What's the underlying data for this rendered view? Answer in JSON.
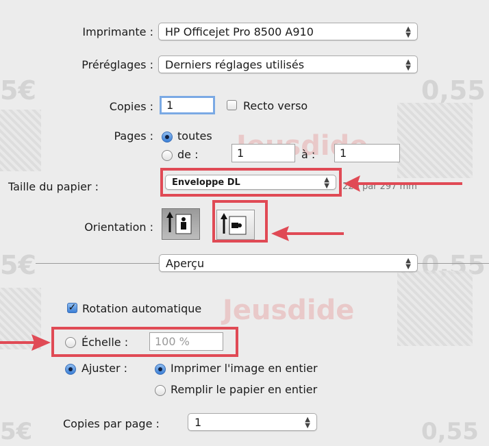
{
  "printer": {
    "label": "Imprimante :",
    "value": "HP Officejet Pro 8500 A910"
  },
  "presets": {
    "label": "Préréglages :",
    "value": "Derniers réglages utilisés"
  },
  "copies": {
    "label": "Copies :",
    "value": "1",
    "duplex_label": "Recto verso",
    "duplex_checked": false
  },
  "pages": {
    "label": "Pages :",
    "all_label": "toutes",
    "from_label": "de :",
    "from_value": "1",
    "to_label": "à :",
    "to_value": "1",
    "selected": "toutes"
  },
  "paper_size": {
    "label": "Taille du papier :",
    "value": "Enveloppe DL",
    "dimensions": "220 par 297 mm"
  },
  "orientation": {
    "label": "Orientation :",
    "portrait_icon": "portrait-orientation-icon",
    "landscape_icon": "landscape-orientation-icon"
  },
  "section": {
    "value": "Aperçu"
  },
  "auto_rotate": {
    "label": "Rotation automatique",
    "checked": true
  },
  "scale": {
    "label": "Échelle :",
    "value": "100 %"
  },
  "fit": {
    "label": "Ajuster :",
    "option1": "Imprimer l'image en entier",
    "option2": "Remplir le papier en entier"
  },
  "copies_per_page": {
    "label": "Copies par page :",
    "value": "1"
  },
  "background": {
    "stamp_value": "0,55",
    "stamp_value_left": "5€",
    "watermark": "Jeusdide"
  },
  "annotation_color": "#e04a55"
}
